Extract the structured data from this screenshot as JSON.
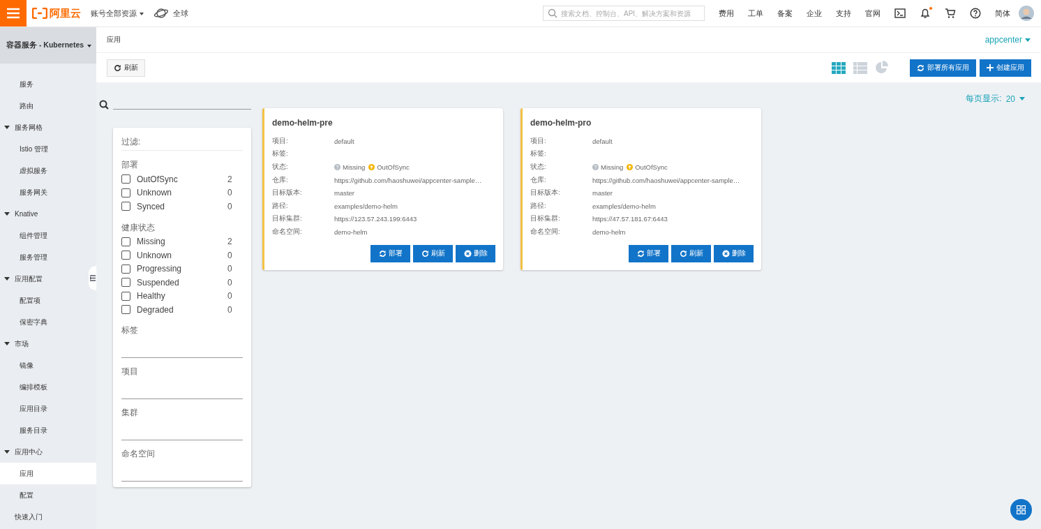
{
  "header": {
    "brand": "阿里云",
    "account_menu": "账号全部资源",
    "region": "全球",
    "search": {
      "placeholder": "搜索文档、控制台、API、解决方案和资源"
    },
    "links": [
      "费用",
      "工单",
      "备案",
      "企业",
      "支持",
      "官网"
    ],
    "icons": [
      {
        "kind": "terminal",
        "badge": false
      },
      {
        "kind": "bell",
        "badge": true
      },
      {
        "kind": "cart",
        "badge": false
      },
      {
        "kind": "help",
        "badge": false
      }
    ],
    "language": "简体"
  },
  "sidebar": {
    "title": "容器服务 - Kubernetes",
    "continued_items": [
      {
        "label": "服务",
        "selected": false
      },
      {
        "label": "路由",
        "selected": false
      }
    ],
    "items": [
      {
        "label": "服务网格",
        "expanded": true,
        "children": [
          {
            "label": "Istio 管理",
            "selected": false
          },
          {
            "label": "虚拟服务",
            "selected": false
          },
          {
            "label": "服务网关",
            "selected": false
          }
        ]
      },
      {
        "label": "Knative",
        "expanded": true,
        "children": [
          {
            "label": "组件管理",
            "selected": false
          },
          {
            "label": "服务管理",
            "selected": false
          }
        ]
      },
      {
        "label": "应用配置",
        "expanded": true,
        "children": [
          {
            "label": "配置项",
            "selected": false
          },
          {
            "label": "保密字典",
            "selected": false
          }
        ]
      },
      {
        "label": "市场",
        "expanded": true,
        "children": [
          {
            "label": "镜像",
            "selected": false
          },
          {
            "label": "编排模板",
            "selected": false
          },
          {
            "label": "应用目录",
            "selected": false
          },
          {
            "label": "服务目录",
            "selected": false
          }
        ]
      },
      {
        "label": "应用中心",
        "expanded": true,
        "children": [
          {
            "label": "应用",
            "selected": true
          },
          {
            "label": "配置",
            "selected": false
          }
        ]
      },
      {
        "label": "快速入门",
        "selected": false
      }
    ]
  },
  "breadcrumb": "应用",
  "namespace_menu": "appcenter",
  "toolbar": {
    "refresh": "刷新",
    "views": [
      {
        "kind": "grid",
        "selected": true
      },
      {
        "kind": "list",
        "selected": false
      },
      {
        "kind": "pie",
        "selected": false
      }
    ],
    "actions": [
      {
        "label": "部署所有应用",
        "kind": "sync"
      },
      {
        "label": "创建应用",
        "kind": "add"
      }
    ]
  },
  "page_size": {
    "label": "每页显示:",
    "value": "20"
  },
  "filter": {
    "title": "过滤:",
    "groups": [
      {
        "title": "部署",
        "options": [
          {
            "label": "OutOfSync",
            "count": "2",
            "checked": false
          },
          {
            "label": "Unknown",
            "count": "0",
            "checked": false
          },
          {
            "label": "Synced",
            "count": "0",
            "checked": false
          }
        ]
      },
      {
        "title": "健康状态",
        "options": [
          {
            "label": "Missing",
            "count": "2",
            "checked": false
          },
          {
            "label": "Unknown",
            "count": "0",
            "checked": false
          },
          {
            "label": "Progressing",
            "count": "0",
            "checked": false
          },
          {
            "label": "Suspended",
            "count": "0",
            "checked": false
          },
          {
            "label": "Healthy",
            "count": "0",
            "checked": false
          },
          {
            "label": "Degraded",
            "count": "0",
            "checked": false
          }
        ]
      }
    ],
    "fields": [
      "标签",
      "项目",
      "集群",
      "命名空间"
    ]
  },
  "apps": [
    {
      "name": "demo-helm-pre",
      "fields": [
        {
          "label": "项目:",
          "kind": "text",
          "value": "default"
        },
        {
          "label": "标签:",
          "kind": "text"
        },
        {
          "label": "状态:",
          "kind": "status",
          "health": "Missing",
          "sync": "OutOfSync"
        },
        {
          "label": "仓库:",
          "kind": "text",
          "value": "https://github.com/haoshuwei/appcenter-sample…"
        },
        {
          "label": "目标版本:",
          "kind": "text",
          "value": "master"
        },
        {
          "label": "路径:",
          "kind": "text",
          "value": "examples/demo-helm"
        },
        {
          "label": "目标集群:",
          "kind": "text",
          "value": "https://123.57.243.199:6443"
        },
        {
          "label": "命名空间:",
          "kind": "text",
          "value": "demo-helm"
        }
      ],
      "buttons": [
        {
          "label": "部署",
          "kind": "sync"
        },
        {
          "label": "刷新",
          "kind": "refresh"
        },
        {
          "label": "删除",
          "kind": "delete"
        }
      ]
    },
    {
      "name": "demo-helm-pro",
      "fields": [
        {
          "label": "项目:",
          "kind": "text",
          "value": "default"
        },
        {
          "label": "标签:",
          "kind": "text"
        },
        {
          "label": "状态:",
          "kind": "status",
          "health": "Missing",
          "sync": "OutOfSync"
        },
        {
          "label": "仓库:",
          "kind": "text",
          "value": "https://github.com/haoshuwei/appcenter-sample…"
        },
        {
          "label": "目标版本:",
          "kind": "text",
          "value": "master"
        },
        {
          "label": "路径:",
          "kind": "text",
          "value": "examples/demo-helm"
        },
        {
          "label": "目标集群:",
          "kind": "text",
          "value": "https://47.57.181.67:6443"
        },
        {
          "label": "命名空间:",
          "kind": "text",
          "value": "demo-helm"
        }
      ],
      "buttons": [
        {
          "label": "部署",
          "kind": "sync"
        },
        {
          "label": "刷新",
          "kind": "refresh"
        },
        {
          "label": "删除",
          "kind": "delete"
        }
      ]
    }
  ]
}
